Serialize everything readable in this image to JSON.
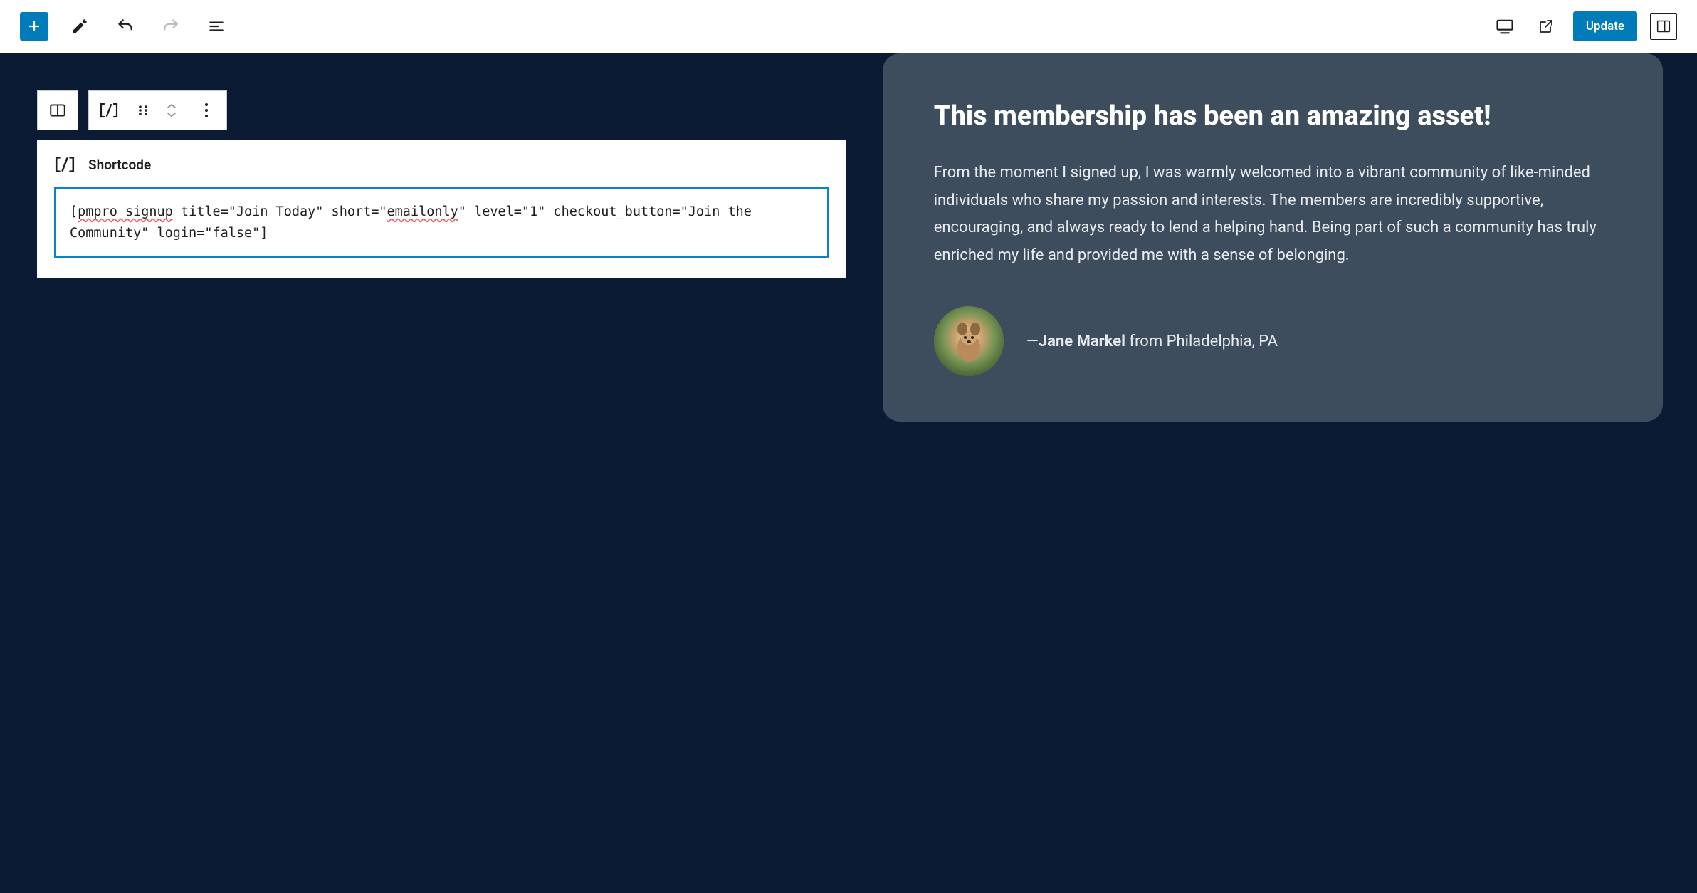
{
  "toolbar": {
    "update_label": "Update"
  },
  "shortcode_block": {
    "label": "Shortcode",
    "content_parts": {
      "p1": "[",
      "p2_spell": "pmpro_signup",
      "p3": " title=\"Join Today\" short=\"",
      "p4_spell": "emailonly",
      "p5": "\" level=\"1\" checkout_button=\"Join the Community\" login=\"false\"]"
    }
  },
  "testimonial": {
    "heading": "This membership has been an amazing asset!",
    "body": "From the moment I signed up, I was warmly welcomed into a vibrant community of like-minded individuals who share my passion and interests. The members are incredibly supportive, encouraging, and always ready to lend a helping hand. Being part of such a community has truly enriched my life and provided me with a sense of belonging.",
    "author_dash": "—",
    "author_name": "Jane Markel",
    "author_location": " from Philadelphia, PA"
  }
}
